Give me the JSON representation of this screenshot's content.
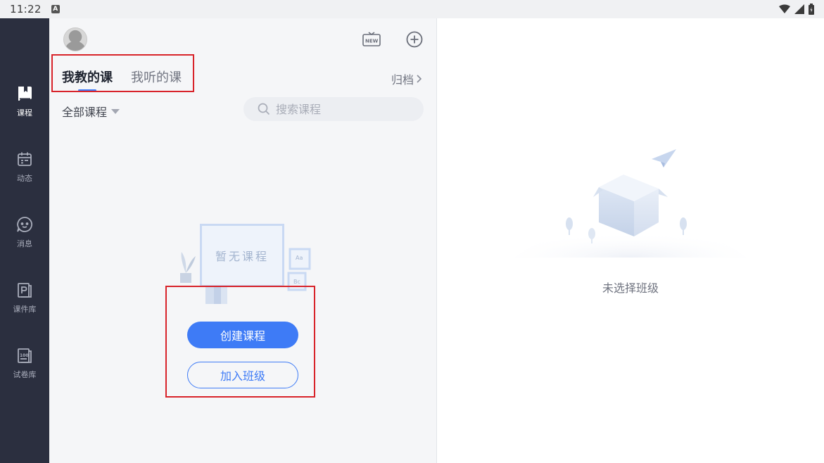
{
  "status_bar": {
    "time": "11:22",
    "notification_icon": "a-box-icon",
    "icons": [
      "wifi-icon",
      "signal-icon",
      "battery-icon"
    ]
  },
  "rail": {
    "items": [
      {
        "label": "课程",
        "icon": "book-icon",
        "active": true
      },
      {
        "label": "动态",
        "icon": "calendar-icon",
        "active": false
      },
      {
        "label": "消息",
        "icon": "chat-icon",
        "active": false
      },
      {
        "label": "课件库",
        "icon": "courseware-icon",
        "active": false
      },
      {
        "label": "试卷库",
        "icon": "exam-icon",
        "active": false
      }
    ]
  },
  "header": {
    "new_icon": "new-badge-icon",
    "add_icon": "plus-circle-icon"
  },
  "tabs": [
    {
      "label": "我教的课",
      "active": true
    },
    {
      "label": "我听的课",
      "active": false
    }
  ],
  "archive_label": "归档",
  "filter": {
    "label": "全部课程"
  },
  "search": {
    "placeholder": "搜索课程",
    "value": ""
  },
  "empty_courses": {
    "board_text": "暂无课程",
    "tile_a": "Aa",
    "tile_b": "Bc"
  },
  "actions": {
    "create_label": "创建课程",
    "join_label": "加入班级"
  },
  "right_panel": {
    "empty_text": "未选择班级"
  },
  "colors": {
    "accent": "#3e7bf6",
    "rail_bg": "#2b2f3f",
    "highlight_box": "#d8232a"
  }
}
